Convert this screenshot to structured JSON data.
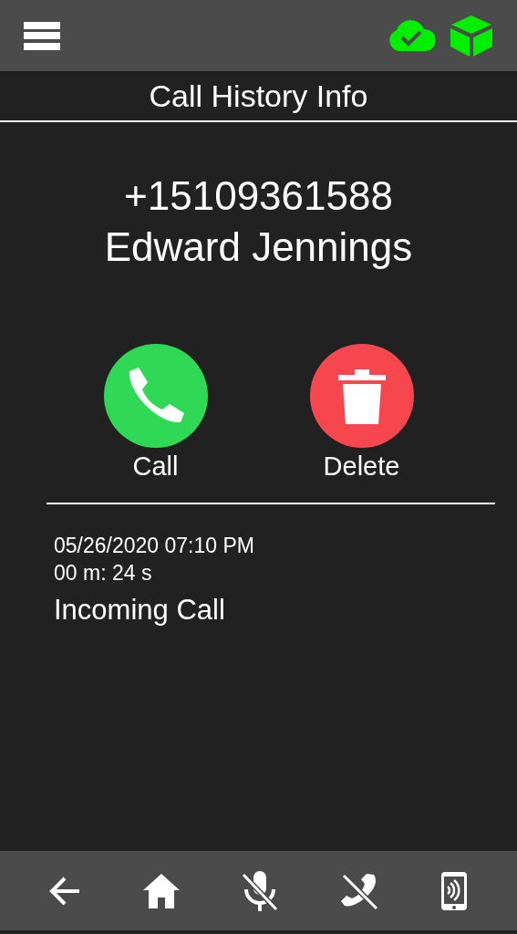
{
  "title": "Call History Info",
  "contact": {
    "number": "+15109361588",
    "name": "Edward Jennings"
  },
  "actions": [
    {
      "kind": "call",
      "label": "Call"
    },
    {
      "kind": "delete",
      "label": "Delete"
    }
  ],
  "record": {
    "datetime": "05/26/2020 07:10 PM",
    "duration": "00 m: 24 s",
    "type": "Incoming Call"
  }
}
